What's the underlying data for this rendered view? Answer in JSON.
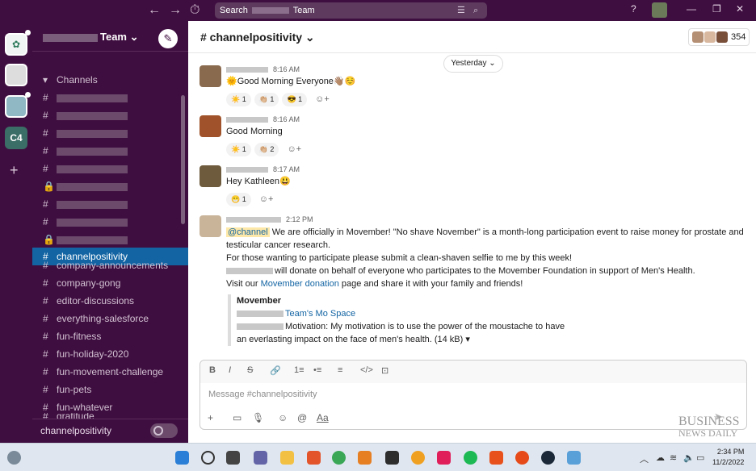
{
  "titlebar": {
    "back": "←",
    "forward": "→",
    "history": "⏱",
    "search_label": "Search",
    "search_suffix": "Team",
    "filter_icon": "☰",
    "search_icon": "⌕",
    "help": "?",
    "minimize": "—",
    "restore": "❐",
    "close": "✕"
  },
  "rail": {
    "c4_label": "C4",
    "add": "+"
  },
  "sidebar": {
    "team_suffix": "Team ⌄",
    "compose": "✎",
    "channels_header": "Channels",
    "active_channel": "channelpositivity",
    "channels": [
      "company-announcements",
      "company-gong",
      "editor-discussions",
      "everything-salesforce",
      "fun-fitness",
      "fun-holiday-2020",
      "fun-movement-challenge",
      "fun-pets",
      "fun-whatever",
      "gratitude"
    ],
    "footer_label": "channelpositivity"
  },
  "channel": {
    "name": "# channelpositivity ⌄",
    "member_count": "354",
    "date_pill": "Yesterday ⌄"
  },
  "messages": [
    {
      "time": "8:16 AM",
      "text": "🌞Good Morning Everyone👋🏽☺️",
      "reactions": [
        "☀️ 1",
        "👏🏼 1",
        "😎 1"
      ]
    },
    {
      "time": "8:16 AM",
      "text": "Good Morning",
      "reactions": [
        "☀️ 1",
        "👏🏼 2"
      ]
    },
    {
      "time": "8:17 AM",
      "text": "Hey Kathleen😃",
      "reactions": [
        "😁 1"
      ]
    },
    {
      "time": "2:12 PM",
      "mention": "@channel",
      "line1": " We are officially in Movember! \"No shave November\" is a month-long participation event to raise money for prostate and",
      "line2": "testicular cancer research.",
      "line3": "For those wanting to participate please submit a clean-shaven selfie to me by this week!",
      "line4": "will donate on behalf of everyone who participates to the Movember Foundation in support of Men's Health.",
      "line5_pre": "Visit our ",
      "line5_link": "Movember donation",
      "line5_post": " page and share it with your family and friends!",
      "attachment": {
        "title": "Movember",
        "team_link": "Team's Mo Space",
        "desc1": "Motivation: My motivation is to use the power of the moustache to have",
        "desc2": "an everlasting impact on the face of men's health. (14 kB) ▾"
      }
    }
  ],
  "composer": {
    "placeholder": "Message #channelpositivity",
    "format_icons": [
      "B",
      "I",
      "S",
      "🔗",
      "1≡",
      "•≡",
      "≡",
      "</>",
      "⊡"
    ],
    "bottom_icons": [
      "+",
      "▭",
      "🎙",
      "☺",
      "@",
      "Aa"
    ],
    "send": "➤"
  },
  "watermark": {
    "line1": "BUSINESS",
    "line2": "NEWS DAILY"
  },
  "taskbar": {
    "time": "2:34 PM",
    "date": "11/2/2022"
  },
  "colors": {
    "aubergine": "#3f0e40",
    "active_blue": "#1264a3",
    "mention_bg": "#fde8a9"
  }
}
